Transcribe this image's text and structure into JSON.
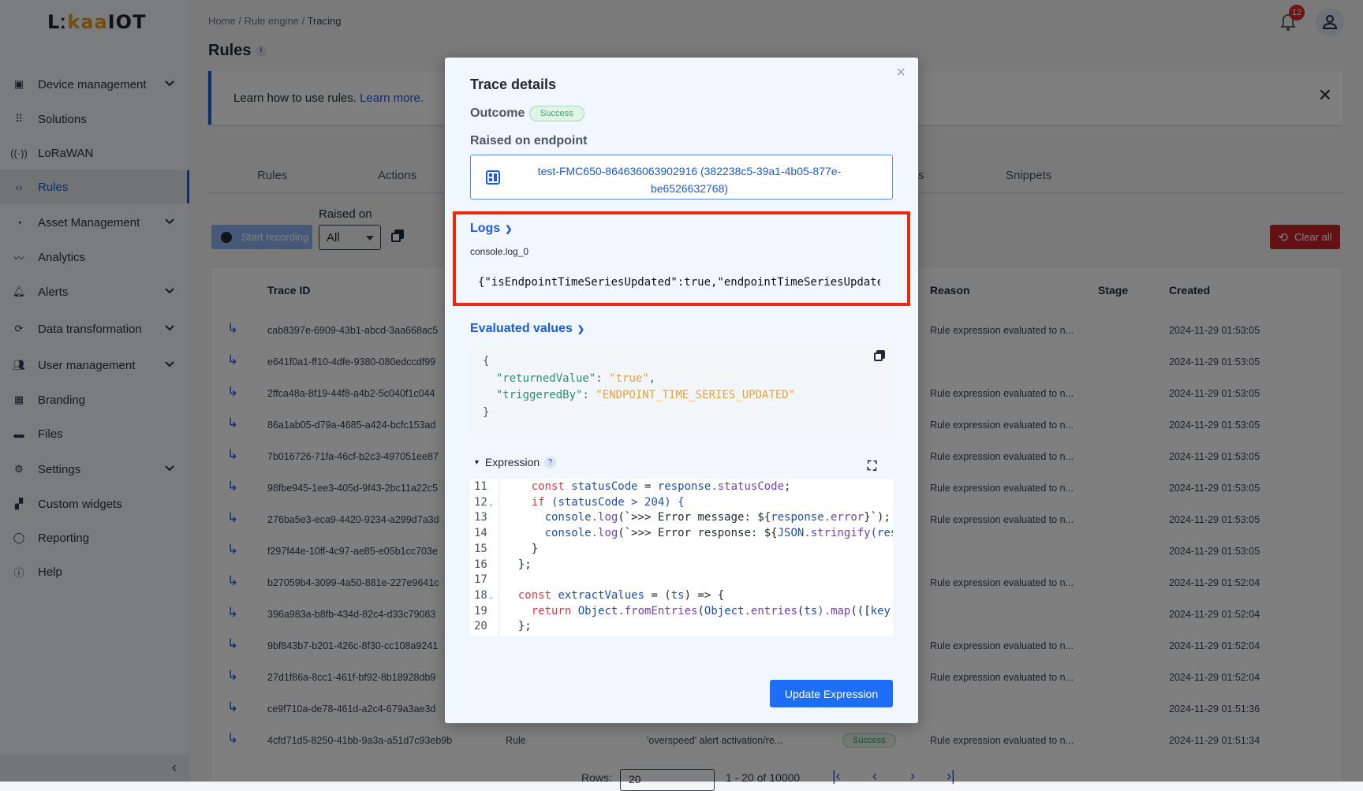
{
  "brand": {
    "logo_text_a": "Lː",
    "logo_text_b": "kaa",
    "logo_text_c": "IOT"
  },
  "sidebar": {
    "items": [
      {
        "label": "Device management",
        "icon": "device-icon",
        "expandable": true
      },
      {
        "label": "Solutions",
        "icon": "grid-icon",
        "expandable": false
      },
      {
        "label": "LoRaWAN",
        "icon": "antenna-icon",
        "expandable": false
      },
      {
        "label": "Rules",
        "icon": "code-icon",
        "expandable": false,
        "active": true
      },
      {
        "label": "Asset Management",
        "icon": "asset-icon",
        "expandable": true
      },
      {
        "label": "Analytics",
        "icon": "analytics-icon",
        "expandable": false
      },
      {
        "label": "Alerts",
        "icon": "bell-icon",
        "expandable": true
      },
      {
        "label": "Data transformation",
        "icon": "transform-icon",
        "expandable": true
      },
      {
        "label": "User management",
        "icon": "users-icon",
        "expandable": true
      },
      {
        "label": "Branding",
        "icon": "branding-icon",
        "expandable": false
      },
      {
        "label": "Files",
        "icon": "folder-icon",
        "expandable": false
      },
      {
        "label": "Settings",
        "icon": "gear-icon",
        "expandable": true
      },
      {
        "label": "Custom widgets",
        "icon": "widgets-icon",
        "expandable": false
      },
      {
        "label": "Reporting",
        "icon": "reporting-icon",
        "expandable": false
      },
      {
        "label": "Help",
        "icon": "help-icon",
        "expandable": false
      }
    ],
    "collapse": "‹"
  },
  "breadcrumb": {
    "home": "Home",
    "sep": "/",
    "engine": "Rule engine",
    "current": "Tracing"
  },
  "header": {
    "title": "Rules",
    "notifications": "12"
  },
  "banner": {
    "text": "Learn how to use rules. ",
    "link": "Learn more."
  },
  "tabs": [
    "Rules",
    "Actions",
    "s",
    "Snippets"
  ],
  "toolbar": {
    "start_recording": "Start recording",
    "raised_on_label": "Raised on",
    "raised_on_value": "All",
    "clear_all": "Clear all"
  },
  "table": {
    "headers": {
      "trace_id": "Trace ID",
      "reason": "Reason",
      "stage": "Stage",
      "created": "Created"
    },
    "rows": [
      {
        "id": "cab8397e-6909-43b1-abcd-3aa668ac5",
        "reason": "Rule expression evaluated to n...",
        "created": "2024-11-29 01:53:05"
      },
      {
        "id": "e641f0a1-ff10-4dfe-9380-080edccdf99",
        "reason": "",
        "created": "2024-11-29 01:53:05"
      },
      {
        "id": "2ffca48a-8f19-44f8-a4b2-5c040f1c044",
        "reason": "Rule expression evaluated to n...",
        "created": "2024-11-29 01:53:05"
      },
      {
        "id": "86a1ab05-d79a-4685-a424-bcfc153ad",
        "reason": "Rule expression evaluated to n...",
        "created": "2024-11-29 01:53:05"
      },
      {
        "id": "7b016726-71fa-46cf-b2c3-497051ee87",
        "reason": "Rule expression evaluated to n...",
        "created": "2024-11-29 01:53:05"
      },
      {
        "id": "98fbe945-1ee3-405d-9f43-2bc11a22c5",
        "reason": "Rule expression evaluated to n...",
        "created": "2024-11-29 01:53:05"
      },
      {
        "id": "276ba5e3-eca9-4420-9234-a299d7a3d",
        "reason": "Rule expression evaluated to n...",
        "created": "2024-11-29 01:53:05"
      },
      {
        "id": "f297f44e-10ff-4c97-ae85-e05b1cc703e",
        "reason": "",
        "created": "2024-11-29 01:53:05"
      },
      {
        "id": "b27059b4-3099-4a50-881e-227e9641c",
        "reason": "Rule expression evaluated to n...",
        "created": "2024-11-29 01:52:04"
      },
      {
        "id": "396a983a-b8fb-434d-82c4-d33c79083",
        "reason": "",
        "created": "2024-11-29 01:52:04"
      },
      {
        "id": "9bf843b7-b201-426c-8f30-cc108a9241",
        "reason": "Rule expression evaluated to n...",
        "created": "2024-11-29 01:52:04"
      },
      {
        "id": "27d1f86a-8cc1-461f-bf92-8b18928db9",
        "reason": "Rule expression evaluated to n...",
        "created": "2024-11-29 01:52:04"
      },
      {
        "id": "ce9f710a-de78-461d-a2c4-679a3ae3d",
        "reason": "",
        "created": "2024-11-29 01:51:36"
      },
      {
        "id": "4cfd71d5-8250-41bb-9a3a-a51d7c93eb9b",
        "type": "Rule",
        "name": "'overspeed' alert activation/re...",
        "status": "Success",
        "reason": "Rule expression evaluated to n...",
        "created": "2024-11-29 01:51:34"
      }
    ]
  },
  "pagination": {
    "rows_label": "Rows:",
    "rows_value": "20",
    "range": "1 - 20 of 10000"
  },
  "modal": {
    "title": "Trace details",
    "close": "×",
    "outcome_label": "Outcome",
    "outcome": "Success",
    "raised_label": "Raised on endpoint",
    "endpoint": "test-FMC650-864636063902916 (382238c5-39a1-4b05-877e-be6526632768)",
    "logs_label": "Logs",
    "log_key": "console.log_0",
    "log_value": "{\"isEndpointTimeSeriesUpdated\":true,\"endpointTimeSeriesUpdated\"",
    "evaluated_label": "Evaluated values",
    "evaluated": {
      "open": "{",
      "k1": "\"returnedValue\"",
      "v1": "\"true\"",
      "k2": "\"triggeredBy\"",
      "v2": "\"ENDPOINT_TIME_SERIES_UPDATED\"",
      "close": "}"
    },
    "expression_label": "Expression",
    "help": "?",
    "code": [
      {
        "n": "11",
        "t": [
          [
            "    ",
            "tx"
          ],
          [
            "const ",
            "kw"
          ],
          [
            "statusCode ",
            "id"
          ],
          [
            "= ",
            "tx"
          ],
          [
            "response",
            "id"
          ],
          [
            ".statusCode",
            "pr"
          ],
          [
            ";",
            "tx"
          ]
        ]
      },
      {
        "n": "12",
        "fold": true,
        "t": [
          [
            "    ",
            "tx"
          ],
          [
            "if ",
            "kw"
          ],
          [
            "(statusCode > 204) {",
            "id"
          ]
        ]
      },
      {
        "n": "13",
        "t": [
          [
            "      ",
            "tx"
          ],
          [
            "console",
            "id"
          ],
          [
            ".log",
            "pr"
          ],
          [
            "(`>>> Error message: ${",
            "tx"
          ],
          [
            "response",
            "id"
          ],
          [
            ".error",
            "pr"
          ],
          [
            "}`);",
            "tx"
          ]
        ]
      },
      {
        "n": "14",
        "t": [
          [
            "      ",
            "tx"
          ],
          [
            "console",
            "id"
          ],
          [
            ".log",
            "pr"
          ],
          [
            "(`>>> Error response: ${",
            "tx"
          ],
          [
            "JSON",
            "id"
          ],
          [
            ".stringify",
            "pr"
          ],
          [
            "(res",
            "id"
          ]
        ]
      },
      {
        "n": "15",
        "t": [
          [
            "    }",
            "tx"
          ]
        ]
      },
      {
        "n": "16",
        "t": [
          [
            "  };",
            "tx"
          ]
        ]
      },
      {
        "n": "17",
        "t": []
      },
      {
        "n": "18",
        "fold": true,
        "t": [
          [
            "  ",
            "tx"
          ],
          [
            "const ",
            "kw"
          ],
          [
            "extractValues ",
            "id"
          ],
          [
            "= (",
            "tx"
          ],
          [
            "ts",
            "id"
          ],
          [
            ") => {",
            "tx"
          ]
        ]
      },
      {
        "n": "19",
        "t": [
          [
            "    ",
            "tx"
          ],
          [
            "return ",
            "kw"
          ],
          [
            "Object",
            "id"
          ],
          [
            ".fromEntries",
            "pr"
          ],
          [
            "(",
            "tx"
          ],
          [
            "Object",
            "id"
          ],
          [
            ".entries",
            "pr"
          ],
          [
            "(",
            "tx"
          ],
          [
            "ts",
            "id"
          ],
          [
            ").map",
            "pr"
          ],
          [
            "(([",
            "tx"
          ],
          [
            "key,",
            "id"
          ]
        ]
      },
      {
        "n": "20",
        "t": [
          [
            "  };",
            "tx"
          ]
        ]
      }
    ],
    "update_button": "Update Expression"
  },
  "colors": {
    "accent": "#1e5bd8",
    "danger": "#c8232c",
    "success": "#34a35a",
    "highlight": "#f0280e"
  }
}
